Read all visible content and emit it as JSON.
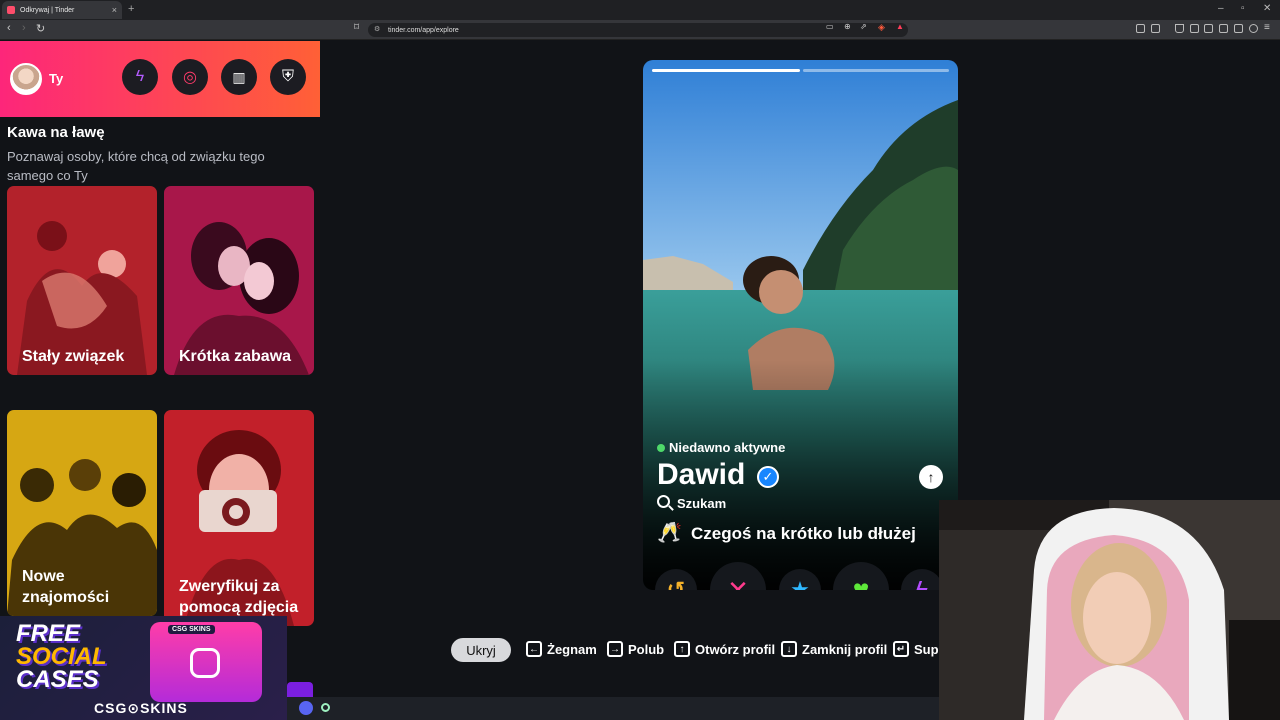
{
  "browser": {
    "tab_title": "Odkrywaj | Tinder",
    "url": "tinder.com/app/explore"
  },
  "sidebar": {
    "user_name": "Ty",
    "section_title": "Kawa na ławę",
    "section_subtitle": "Poznawaj osoby, które chcą od związku tego samego co Ty",
    "cards": [
      {
        "label": "Stały związek",
        "color": "#b3222b"
      },
      {
        "label": "Krótka zabawa",
        "color": "#a8174a"
      },
      {
        "label": "Nowe znajomości",
        "color": "#d6a713"
      },
      {
        "label": "Zweryfikuj za pomocą zdjęcia",
        "color": "#c2202a"
      }
    ],
    "header_icons": [
      "boost-icon",
      "explore-icon",
      "work-icon",
      "safety-icon"
    ]
  },
  "ad": {
    "line1": "FREE",
    "line2": "SOCIAL",
    "line3": "CASES",
    "brand": "CSG⊙SKINS",
    "badge": "CSG SKINS"
  },
  "profile": {
    "status": "Niedawno aktywne",
    "name": "Dawid",
    "looking_label": "Szukam",
    "goal": "Czegoś na krótko lub dłużej",
    "goal_icon": "🥂",
    "photo_count": 2,
    "active_photo": 1
  },
  "actions": [
    {
      "name": "rewind-button",
      "glyph": "↺",
      "color": "#f6b22a"
    },
    {
      "name": "nope-button",
      "glyph": "✕",
      "color": "#ff3b8d"
    },
    {
      "name": "superlike-button",
      "glyph": "★",
      "color": "#2fb8ff"
    },
    {
      "name": "like-button",
      "glyph": "♥",
      "color": "#5ee83a"
    },
    {
      "name": "boost-button",
      "glyph": "ϟ",
      "color": "#b44cff"
    }
  ],
  "shortcuts": {
    "hide": "Ukryj",
    "items": [
      {
        "key": "←",
        "label": "Żegnam"
      },
      {
        "key": "→",
        "label": "Polub"
      },
      {
        "key": "↑",
        "label": "Otwórz profil"
      },
      {
        "key": "↓",
        "label": "Zamknij profil"
      },
      {
        "key": "↵",
        "label": "Sup"
      }
    ]
  }
}
